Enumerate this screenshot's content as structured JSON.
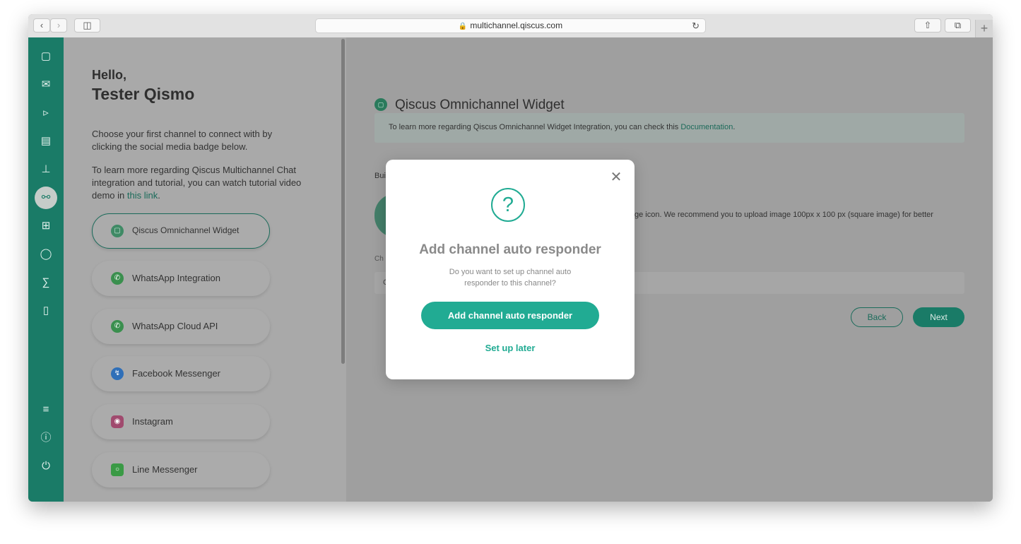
{
  "browser": {
    "url": "multichannel.qiscus.com"
  },
  "sidebar": {
    "icons": [
      "chat-icon",
      "mail-icon",
      "megaphone-icon",
      "contact-card-icon",
      "analytics-icon",
      "integration-icon",
      "apps-icon",
      "agent-icon",
      "ticket-icon",
      "mobile-icon",
      "settings-sliders-icon",
      "help-icon",
      "power-icon"
    ],
    "active": "integration-icon"
  },
  "greeting": {
    "hello": "Hello,",
    "name": "Tester Qismo",
    "intro": "Choose your first channel to connect with by clicking the social media badge below.",
    "tutorial_prefix": "To learn more regarding Qiscus Multichannel Chat integration and tutorial, you can watch tutorial video demo in ",
    "tutorial_link": "this link",
    "tutorial_suffix": "."
  },
  "channels": [
    {
      "label": "Qiscus Omnichannel Widget",
      "icon": "qiscus-icon",
      "selected": true
    },
    {
      "label": "WhatsApp Integration",
      "icon": "whatsapp-icon"
    },
    {
      "label": "WhatsApp Cloud API",
      "icon": "whatsapp-icon"
    },
    {
      "label": "Facebook Messenger",
      "icon": "messenger-icon"
    },
    {
      "label": "Instagram",
      "icon": "instagram-icon"
    },
    {
      "label": "Line Messenger",
      "icon": "line-icon"
    }
  ],
  "widget_panel": {
    "title": "Qiscus Omnichannel Widget",
    "info_prefix": "To learn more regarding Qiscus Omnichannel Widget Integration, you can check this ",
    "info_link": "Documentation",
    "info_suffix": ".",
    "partial_text_1": "Buil",
    "partial_text_2": "ge icon. We recommend you to upload image 100px x 100 px (square image) for better",
    "partial_label": "Ch",
    "partial_input": "C",
    "back_label": "Back",
    "next_label": "Next"
  },
  "modal": {
    "title": "Add channel auto responder",
    "description": "Do you want to set up channel auto responder to this channel?",
    "primary_button": "Add channel auto responder",
    "secondary_link": "Set up later"
  },
  "colors": {
    "brand_green": "#21ab93",
    "sidebar_green": "#1a7b67"
  }
}
